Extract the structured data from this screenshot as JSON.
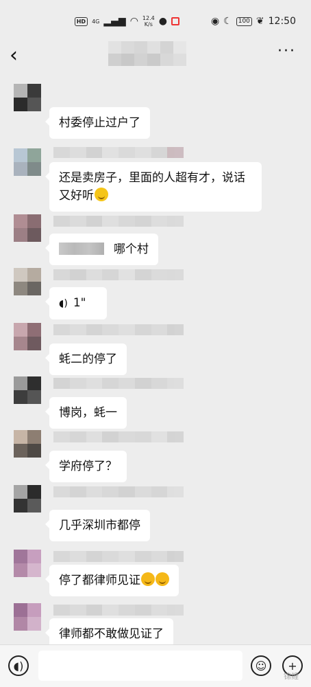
{
  "status_bar": {
    "hd": "HD",
    "net": "4G",
    "speed_value": "12.4",
    "speed_unit": "K/s",
    "battery": "100",
    "time": "12:50"
  },
  "title_bar": {
    "back_icon": "chevron-left-icon",
    "more_label": "···"
  },
  "messages": [
    {
      "text": "村委停止过户了"
    },
    {
      "text": "还是卖房子，里面的人超有才，说话又好听",
      "emoji": "smiling-face"
    },
    {
      "text": "哪个村",
      "has_quote": true
    },
    {
      "text": "1\"",
      "type": "voice"
    },
    {
      "text": "蚝二的停了"
    },
    {
      "text": "博岗，蚝一"
    },
    {
      "text": "学府停了？"
    },
    {
      "text": "几乎深圳市都停"
    },
    {
      "text": "停了都律师见证",
      "emoji_count": 2
    },
    {
      "text": "律师都不敢做见证了"
    }
  ],
  "input_bar": {
    "voice_icon": "voice-icon",
    "emoji_icon": "emoji-icon",
    "plus_icon": "plus-icon",
    "plus_label": "+",
    "emoji_label": "☺"
  },
  "watermark": "锦鲤",
  "colors": {
    "background": "#ededed",
    "bubble": "#ffffff"
  }
}
